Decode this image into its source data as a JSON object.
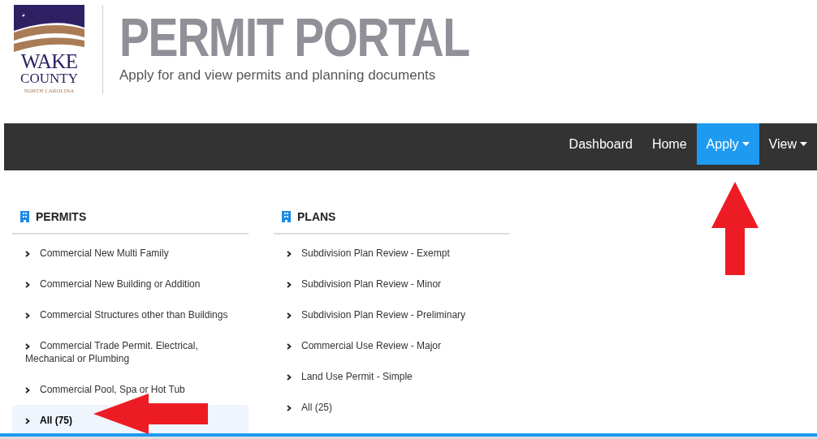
{
  "logo": {
    "line_1": "WAKE",
    "line_2": "COUNTY",
    "line_3": "NORTH CAROLINA"
  },
  "title": "PERMIT PORTAL",
  "subtitle": "Apply for and view permits and planning documents",
  "nav": [
    {
      "label": "Dashboard",
      "selected": false,
      "dropdown": false
    },
    {
      "label": "Home",
      "selected": false,
      "dropdown": false
    },
    {
      "label": "Apply",
      "selected": true,
      "dropdown": true
    },
    {
      "label": "View",
      "selected": false,
      "dropdown": true
    }
  ],
  "sections": [
    {
      "heading": "PERMITS",
      "items": [
        {
          "label": "Commercial New Multi Family",
          "selected": false
        },
        {
          "label": "Commercial New Building or Addition",
          "selected": false
        },
        {
          "label": "Commercial Structures other than Buildings",
          "selected": false
        },
        {
          "label": "Commercial Trade Permit. Electrical, Mechanical or Plumbing",
          "selected": false
        },
        {
          "label": "Commercial Pool, Spa or Hot Tub",
          "selected": false
        },
        {
          "label": "All (75)",
          "selected": true
        }
      ]
    },
    {
      "heading": "PLANS",
      "items": [
        {
          "label": "Subdivision Plan Review - Exempt",
          "selected": false
        },
        {
          "label": "Subdivision Plan Review - Minor",
          "selected": false
        },
        {
          "label": "Subdivision Plan Review - Preliminary",
          "selected": false
        },
        {
          "label": "Commercial Use Review - Major",
          "selected": false
        },
        {
          "label": "Land Use Permit - Simple",
          "selected": false
        },
        {
          "label": "All (25)",
          "selected": false
        }
      ]
    }
  ]
}
